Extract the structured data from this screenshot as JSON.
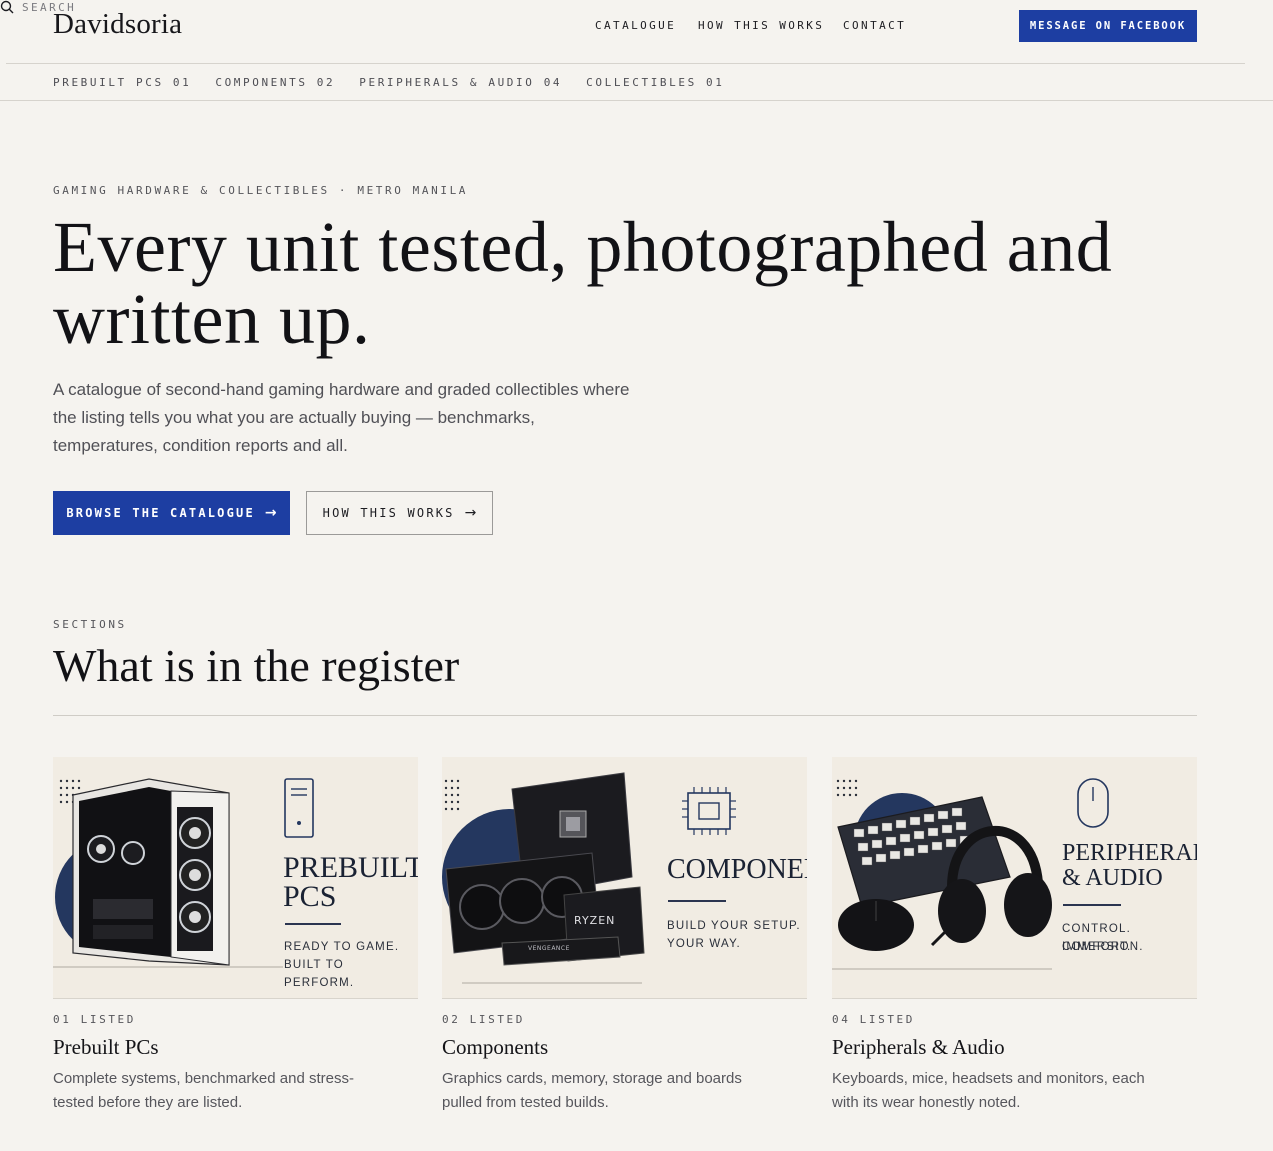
{
  "brand": "Davidsoria",
  "nav": {
    "catalogue": "CATALOGUE",
    "how": "HOW THIS WORKS",
    "contact": "CONTACT",
    "search": "SEARCH",
    "facebook": "MESSAGE ON FACEBOOK"
  },
  "subnav": [
    "PREBUILT PCS 01",
    "COMPONENTS 02",
    "PERIPHERALS & AUDIO 04",
    "COLLECTIBLES 01"
  ],
  "hero": {
    "eyebrow": "GAMING HARDWARE & COLLECTIBLES · METRO MANILA",
    "title": "Every unit tested, photographed and written up.",
    "copy": "A catalogue of second-hand gaming hardware and graded collectibles where the listing tells you what you are actually buying — benchmarks, temperatures, condition reports and all.",
    "primary_cta": "BROWSE THE CATALOGUE",
    "secondary_cta": "HOW THIS WORKS"
  },
  "sections": {
    "eyebrow": "SECTIONS",
    "title": "What is in the register"
  },
  "cards": [
    {
      "img_heading_1": "PREBUILT",
      "img_heading_2": "PCS",
      "img_tag_1": "READY TO GAME.",
      "img_tag_2": "BUILT TO PERFORM.",
      "count": "01 LISTED",
      "title": "Prebuilt PCs",
      "desc": "Complete systems, benchmarked and stress-tested before they are listed."
    },
    {
      "img_heading_1": "COMPONENTS",
      "img_tag_1": "BUILD YOUR SETUP.",
      "img_tag_2": "YOUR WAY.",
      "img_chip": "RYZEN",
      "img_ram": "VENGEANCE",
      "count": "02 LISTED",
      "title": "Components",
      "desc": "Graphics cards, memory, storage and boards pulled from tested builds."
    },
    {
      "img_heading_1": "PERIPHERALS",
      "img_heading_2": "& AUDIO",
      "img_tag_1": "CONTROL. COMFORT.",
      "img_tag_2": "IMMERSION.",
      "count": "04 LISTED",
      "title": "Peripherals & Audio",
      "desc": "Keyboards, mice, headsets and monitors, each with its wear honestly noted."
    }
  ],
  "colors": {
    "accent": "#1d3ea2",
    "background": "#f5f3ef",
    "ink": "#121216",
    "navy_art": "#24375f"
  }
}
